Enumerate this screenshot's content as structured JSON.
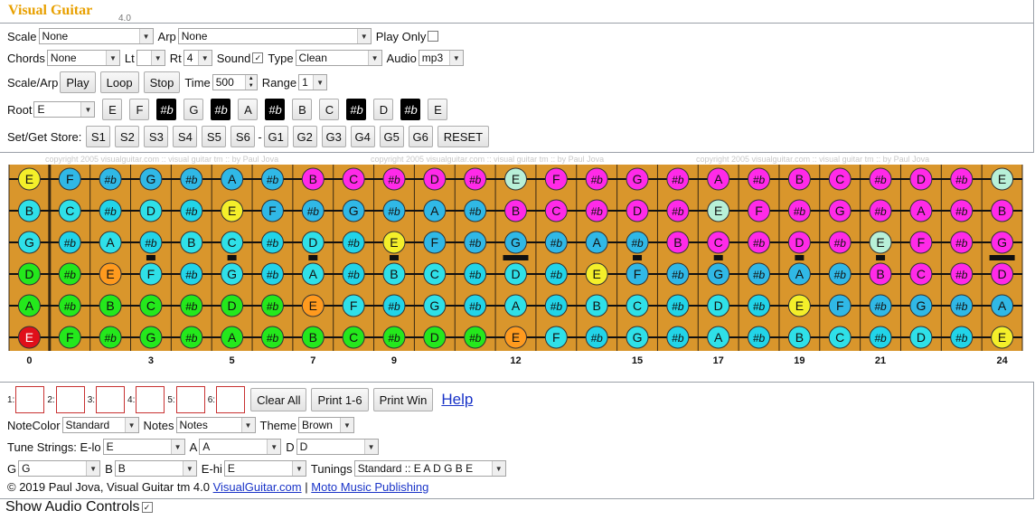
{
  "app": {
    "title": "Visual Guitar",
    "version": "4.0"
  },
  "controls": {
    "scale_label": "Scale",
    "scale_value": "None",
    "arp_label": "Arp",
    "arp_value": "None",
    "play_only_label": "Play Only",
    "chords_label": "Chords",
    "chords_value": "None",
    "lt_label": "Lt",
    "lt_value": "",
    "rt_label": "Rt",
    "rt_value": "4",
    "sound_label": "Sound",
    "type_label": "Type",
    "type_value": "Clean",
    "audio_label": "Audio",
    "audio_value": "mp3",
    "scale_arp_label": "Scale/Arp",
    "play_button": "Play",
    "loop_button": "Loop",
    "stop_button": "Stop",
    "time_label": "Time",
    "time_value": "500",
    "range_label": "Range",
    "range_value": "1",
    "root_label": "Root",
    "root_value": "E",
    "root_notes": [
      "E",
      "F",
      "#b",
      "G",
      "#b",
      "A",
      "#b",
      "B",
      "C",
      "#b",
      "D",
      "#b",
      "E"
    ],
    "store_label": "Set/Get Store:",
    "set_buttons": [
      "S1",
      "S2",
      "S3",
      "S4",
      "S5",
      "S6"
    ],
    "store_separator": "-",
    "get_buttons": [
      "G1",
      "G2",
      "G3",
      "G4",
      "G5",
      "G6"
    ],
    "reset_button": "RESET"
  },
  "fretboard": {
    "watermark": "copyright 2005 visualguitar.com :: visual guitar tm :: by Paul Jova",
    "strings": [
      [
        "E",
        "F",
        "#b",
        "G",
        "#b",
        "A",
        "#b",
        "B",
        "C",
        "#b",
        "D",
        "#b",
        "E",
        "F",
        "#b",
        "G",
        "#b",
        "A",
        "#b",
        "B",
        "C",
        "#b",
        "D",
        "#b",
        "E"
      ],
      [
        "B",
        "C",
        "#b",
        "D",
        "#b",
        "E",
        "F",
        "#b",
        "G",
        "#b",
        "A",
        "#b",
        "B",
        "C",
        "#b",
        "D",
        "#b",
        "E",
        "F",
        "#b",
        "G",
        "#b",
        "A",
        "#b",
        "B"
      ],
      [
        "G",
        "#b",
        "A",
        "#b",
        "B",
        "C",
        "#b",
        "D",
        "#b",
        "E",
        "F",
        "#b",
        "G",
        "#b",
        "A",
        "#b",
        "B",
        "C",
        "#b",
        "D",
        "#b",
        "E",
        "F",
        "#b",
        "G"
      ],
      [
        "D",
        "#b",
        "E",
        "F",
        "#b",
        "G",
        "#b",
        "A",
        "#b",
        "B",
        "C",
        "#b",
        "D",
        "#b",
        "E",
        "F",
        "#b",
        "G",
        "#b",
        "A",
        "#b",
        "B",
        "C",
        "#b",
        "D"
      ],
      [
        "A",
        "#b",
        "B",
        "C",
        "#b",
        "D",
        "#b",
        "E",
        "F",
        "#b",
        "G",
        "#b",
        "A",
        "#b",
        "B",
        "C",
        "#b",
        "D",
        "#b",
        "E",
        "F",
        "#b",
        "G",
        "#b",
        "A"
      ],
      [
        "E",
        "F",
        "#b",
        "G",
        "#b",
        "A",
        "#b",
        "B",
        "C",
        "#b",
        "D",
        "#b",
        "E",
        "F",
        "#b",
        "G",
        "#b",
        "A",
        "#b",
        "B",
        "C",
        "#b",
        "D",
        "#b",
        "E"
      ]
    ],
    "fret_markers": [
      3,
      5,
      7,
      9,
      12,
      15,
      17,
      19,
      21,
      24
    ],
    "fret_numbers": [
      "0",
      "3",
      "5",
      "7",
      "9",
      "12",
      "15",
      "17",
      "19",
      "21",
      "24"
    ],
    "note_colors": {
      "E0": "#e0101a",
      "E1": "#ff9a1e",
      "E2": "#f4ef2a",
      "E3": "#40e8c8",
      "E4": "#b8f0d8",
      "F": "#1ecde8",
      "#b": "#22d4e8",
      "G": "#24e81c",
      "A": "#24e81c",
      "B": "#24e81c",
      "C": "#24e81c",
      "D": "#24e81c",
      "mid": "#30b8e6",
      "high": "#ff2ae8"
    }
  },
  "bottom": {
    "slot_labels": [
      "1:",
      "2:",
      "3:",
      "4:",
      "5:",
      "6:"
    ],
    "clear_all": "Clear All",
    "print_16": "Print 1-6",
    "print_win": "Print Win",
    "help": "Help",
    "notecolor_label": "NoteColor",
    "notecolor_value": "Standard",
    "notes_label": "Notes",
    "notes_value": "Notes",
    "theme_label": "Theme",
    "theme_value": "Brown",
    "tune_label": "Tune Strings: E-lo",
    "tune_elo": "E",
    "tune_a_label": "A",
    "tune_a": "A",
    "tune_d_label": "D",
    "tune_d": "D",
    "tune_g_label": "G",
    "tune_g": "G",
    "tune_b_label": "B",
    "tune_b": "B",
    "tune_ehi_label": "E-hi",
    "tune_ehi": "E",
    "tunings_label": "Tunings",
    "tunings_value": "Standard :: E A D G B E",
    "copyright": "© 2019 Paul Jova, Visual Guitar tm 4.0",
    "link_vg": "VisualGuitar.com",
    "link_sep": "|",
    "link_moto": "Moto Music Publishing",
    "audio_controls": "Show Audio Controls"
  }
}
